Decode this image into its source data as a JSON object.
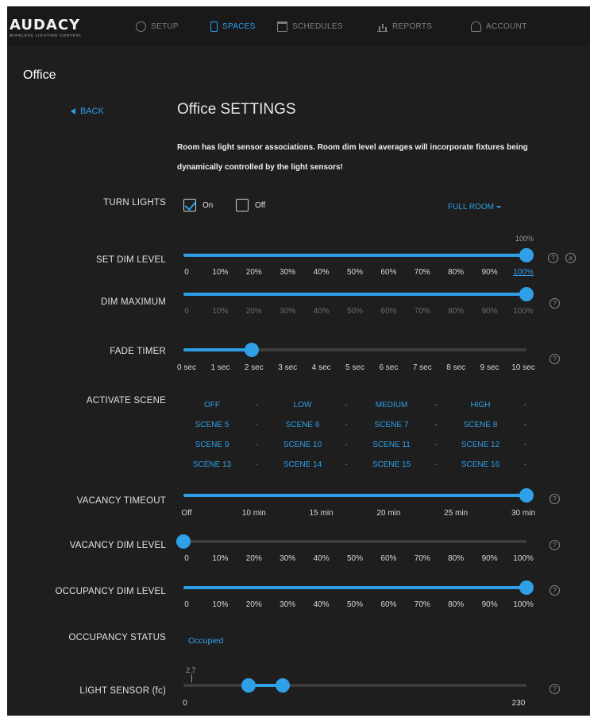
{
  "nav": {
    "logo": "AUDACY",
    "logo_sub": "WIRELESS LIGHTING CONTROL",
    "items": [
      {
        "label": "SETUP",
        "icon": "gear-icon",
        "active": false
      },
      {
        "label": "SPACES",
        "icon": "phone-icon",
        "active": true
      },
      {
        "label": "SCHEDULES",
        "icon": "calendar-icon",
        "active": false
      },
      {
        "label": "REPORTS",
        "icon": "bar-chart-icon",
        "active": false
      },
      {
        "label": "ACCOUNT",
        "icon": "user-icon",
        "active": false
      }
    ]
  },
  "page": {
    "title": "Office",
    "back_label": "BACK",
    "settings_title": "Office SETTINGS",
    "notice": "Room has light sensor associations. Room dim level averages will incorporate fixtures being dynamically controlled by the light sensors!"
  },
  "turn_lights": {
    "label": "TURN LIGHTS",
    "on_label": "On",
    "off_label": "Off",
    "on_checked": true,
    "off_checked": false,
    "scope_label": "FULL ROOM"
  },
  "sliders": {
    "dim_level": {
      "label": "SET DIM LEVEL",
      "value_fraction": 1.0,
      "value_label": "100%",
      "ticks": [
        "0",
        "10%",
        "20%",
        "30%",
        "40%",
        "50%",
        "60%",
        "70%",
        "80%",
        "90%",
        "100%"
      ]
    },
    "dim_max": {
      "label": "DIM MAXIMUM",
      "value_fraction": 1.0,
      "ticks": [
        "0",
        "10%",
        "20%",
        "30%",
        "40%",
        "50%",
        "60%",
        "70%",
        "80%",
        "90%",
        "100%"
      ]
    },
    "fade": {
      "label": "FADE TIMER",
      "value_fraction": 0.2,
      "ticks": [
        "0 sec",
        "1 sec",
        "2 sec",
        "3 sec",
        "4 sec",
        "5 sec",
        "6 sec",
        "7 sec",
        "8 sec",
        "9 sec",
        "10 sec"
      ]
    },
    "vacancy_timeout": {
      "label": "VACANCY TIMEOUT",
      "value_fraction": 1.0,
      "ticks": [
        "Off",
        "10 min",
        "15 min",
        "20 min",
        "25 min",
        "30 min"
      ]
    },
    "vacancy_dim": {
      "label": "VACANCY DIM LEVEL",
      "value_fraction": 0.0,
      "ticks": [
        "0",
        "10%",
        "20%",
        "30%",
        "40%",
        "50%",
        "60%",
        "70%",
        "80%",
        "90%",
        "100%"
      ]
    },
    "occupancy_dim": {
      "label": "OCCUPANCY DIM LEVEL",
      "value_fraction": 1.0,
      "ticks": [
        "0",
        "10%",
        "20%",
        "30%",
        "40%",
        "50%",
        "60%",
        "70%",
        "80%",
        "90%",
        "100%"
      ]
    },
    "light_sensor": {
      "label": "LIGHT SENSOR (fc)",
      "reading": "2.7",
      "min_label": "0",
      "max_label": "230",
      "range_low_fraction": 0.19,
      "range_high_fraction": 0.29
    }
  },
  "scenes": {
    "label": "ACTIVATE SCENE",
    "rows": [
      [
        "OFF",
        "LOW",
        "MEDIUM",
        "HIGH"
      ],
      [
        "SCENE 5",
        "SCENE 6",
        "SCENE 7",
        "SCENE 8"
      ],
      [
        "SCENE 9",
        "SCENE 10",
        "SCENE 11",
        "SCENE 12"
      ],
      [
        "SCENE 13",
        "SCENE 14",
        "SCENE 15",
        "SCENE 16"
      ]
    ],
    "separator": "-"
  },
  "occupancy_status": {
    "label": "OCCUPANCY STATUS",
    "value": "Occupied"
  },
  "help_glyph": "?",
  "lock_glyph": "a"
}
